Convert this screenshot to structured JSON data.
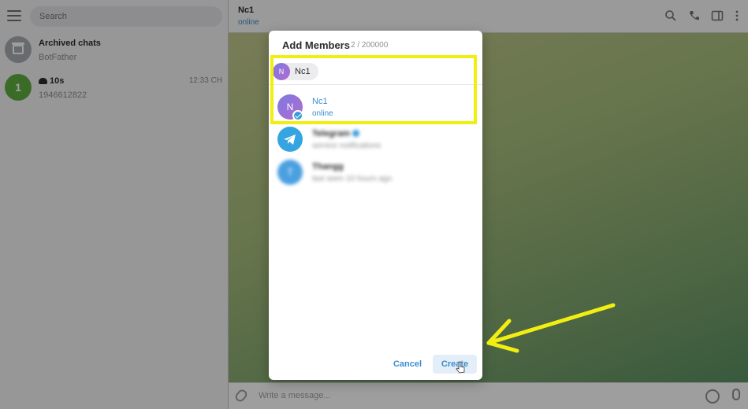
{
  "sidebar": {
    "search_placeholder": "Search",
    "chats": [
      {
        "title": "Archived chats",
        "subtitle": "BotFather",
        "time": ""
      },
      {
        "title": "10s",
        "subtitle": "1946612822",
        "time": "12:33 CH",
        "avatar_letter": "1"
      }
    ]
  },
  "chat": {
    "name": "Nc1",
    "status": "online",
    "composer_placeholder": "Write a message...",
    "header_icons": [
      "search-icon",
      "phone-icon",
      "sidebar-toggle-icon",
      "more-vert-icon"
    ]
  },
  "modal": {
    "title": "Add Members",
    "count": "2 / 200000",
    "chip_label": "Nc1",
    "chip_avatar": "N",
    "contacts": [
      {
        "name": "Nc1",
        "status": "online",
        "avatar_letter": "N",
        "selected": true
      },
      {
        "name": "Telegram",
        "status": "service notifications",
        "avatar_letter": "",
        "blurred": true
      },
      {
        "name": "Thangg",
        "status": "last seen 10 hours ago",
        "avatar_letter": "T",
        "blurred": true
      }
    ],
    "cancel_label": "Cancel",
    "create_label": "Create"
  },
  "colors": {
    "accent": "#3a8fcf",
    "highlight": "#f2ee12",
    "avatar_green": "#5fae3f"
  }
}
